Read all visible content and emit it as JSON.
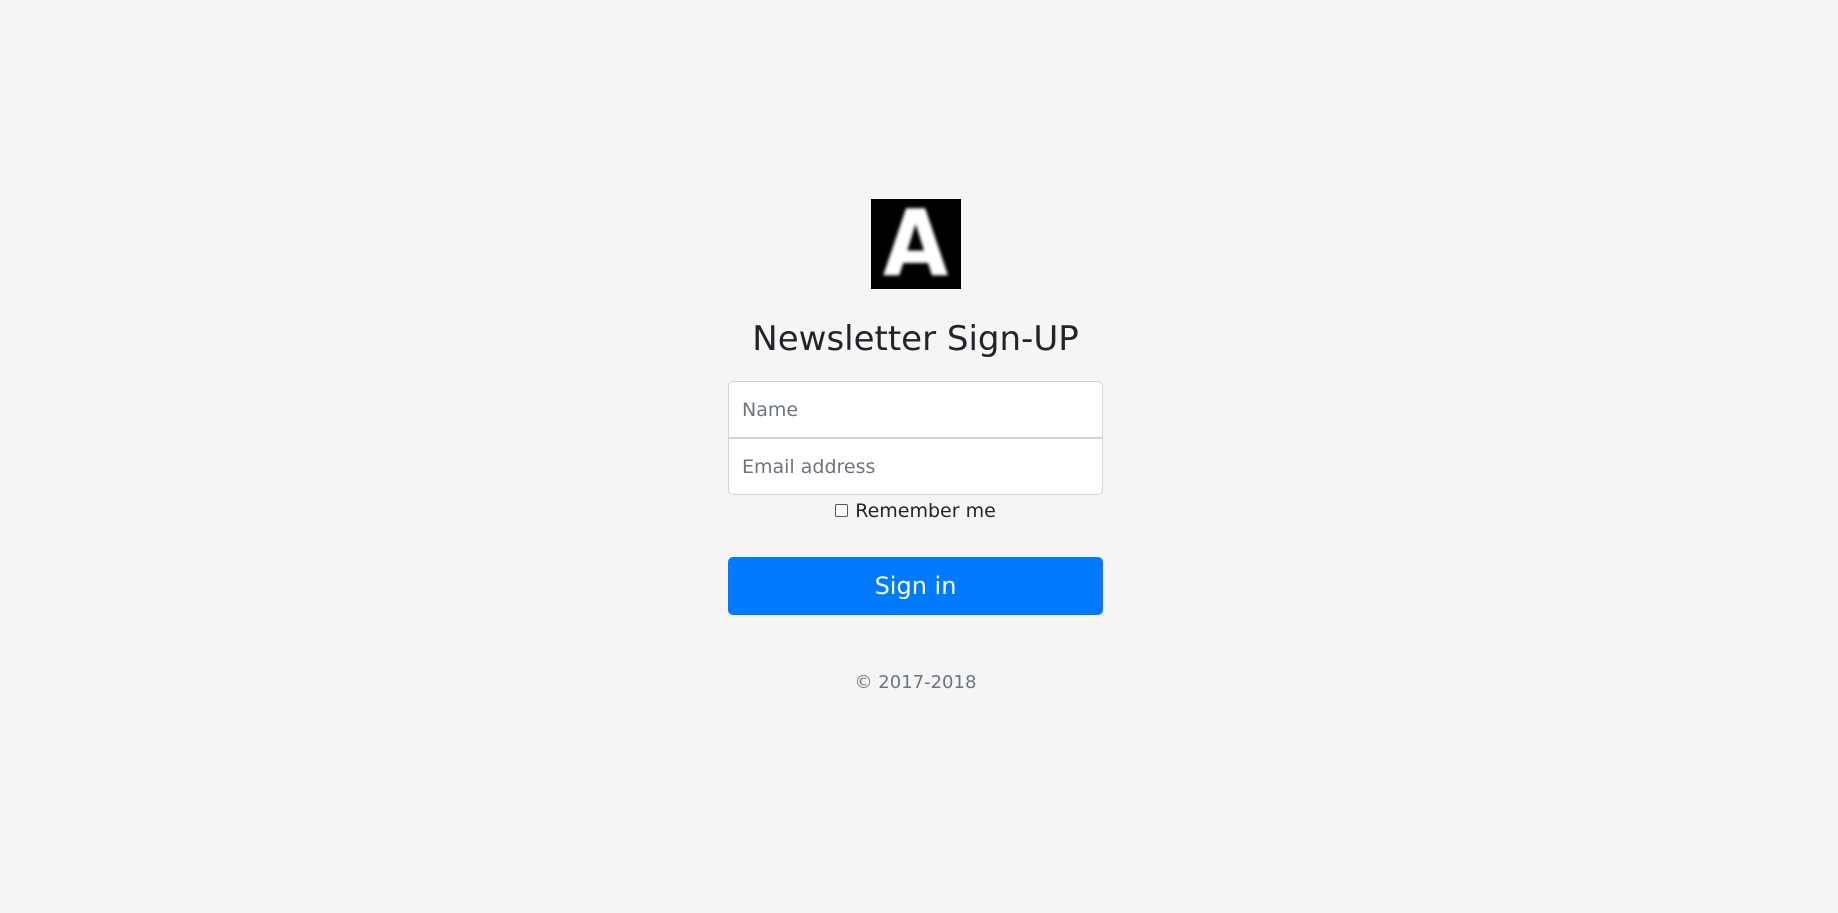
{
  "logo": {
    "letter": "A"
  },
  "form": {
    "title": "Newsletter Sign-UP",
    "name_placeholder": "Name",
    "name_value": "",
    "email_placeholder": "Email address",
    "email_value": "",
    "remember_label": "Remember me",
    "remember_checked": false,
    "submit_label": "Sign in"
  },
  "footer": {
    "copyright": "© 2017-2018"
  },
  "colors": {
    "background": "#f5f5f5",
    "primary": "#007bff",
    "muted": "#6c757d"
  }
}
